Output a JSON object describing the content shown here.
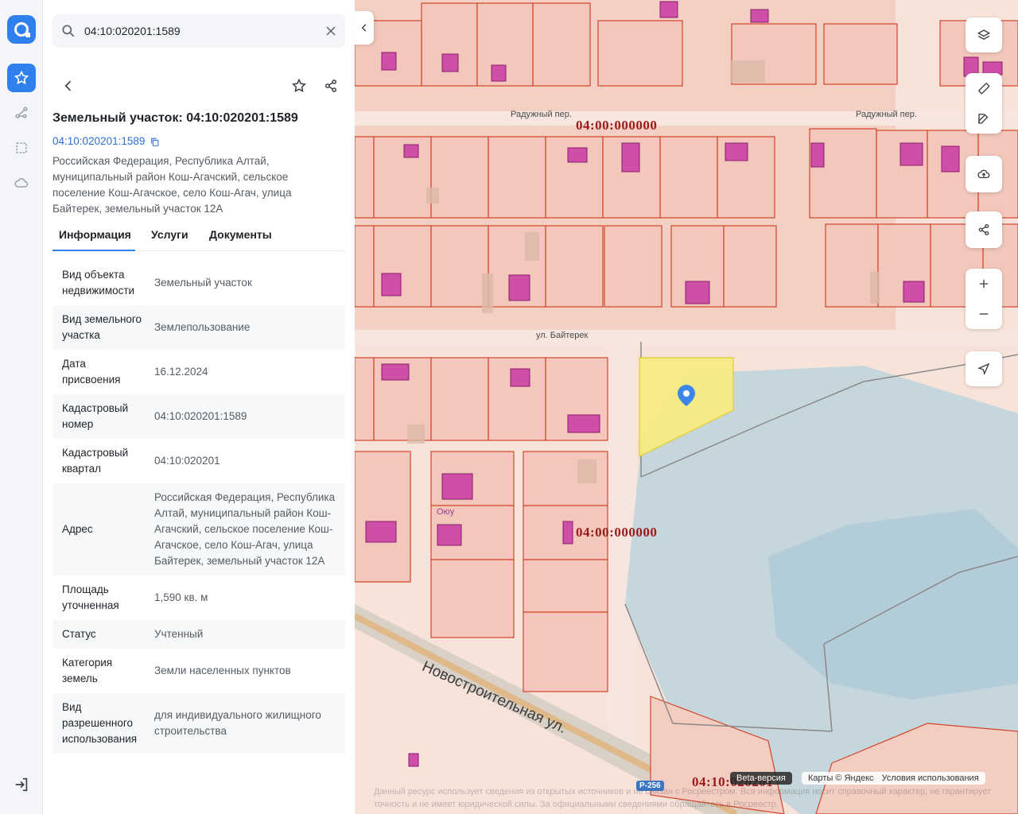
{
  "search": {
    "value": "04:10:020201:1589"
  },
  "panel": {
    "title": "Земельный участок: 04:10:020201:1589",
    "cad_number": "04:10:020201:1589",
    "address": "Российская Федерация, Республика Алтай, муниципальный район Кош-Агачский, сельское поселение Кош-Агачское, село Кош-Агач, улица Байтерек, земельный участок 12А",
    "tabs": [
      "Информация",
      "Услуги",
      "Документы"
    ],
    "properties": [
      {
        "key": "Вид объекта недвижимости",
        "value": "Земельный участок"
      },
      {
        "key": "Вид земельного участка",
        "value": "Землепользование"
      },
      {
        "key": "Дата присвоения",
        "value": "16.12.2024"
      },
      {
        "key": "Кадастровый номер",
        "value": "04:10:020201:1589"
      },
      {
        "key": "Кадастровый квартал",
        "value": "04:10:020201"
      },
      {
        "key": "Адрес",
        "value": "Российская Федерация, Республика Алтай, муниципальный район Кош-Агачский, сельское поселение Кош-Агачское, село Кош-Агач, улица Байтерек, земельный участок 12А"
      },
      {
        "key": "Площадь уточненная",
        "value": "1,590 кв. м"
      },
      {
        "key": "Статус",
        "value": "Учтенный"
      },
      {
        "key": "Категория земель",
        "value": "Земли населенных пунктов"
      },
      {
        "key": "Вид разрешенного использования",
        "value": "для индивидуального жилищного строительства"
      }
    ]
  },
  "map": {
    "streets": {
      "raduzhny": "Радужный пер.",
      "baiterek": "ул. Байтерек",
      "novostroitelnaya": "Новостроительная ул."
    },
    "quarters": [
      "04:00:000000",
      "04:00:000000",
      "04:10:020201"
    ],
    "poi": "Оюу",
    "road": "Р-256",
    "beta": "Beta-версия",
    "copyright": "Карты © Яндекс",
    "terms": "Условия использования",
    "disclaimer": "Данный ресурс использует сведения из открытых источников и не связан с Росреестром. Вся информация носит справочный характер, не гарантирует точность и не имеет юридической силы. За официальными сведениями обращайтесь в Росреестр."
  },
  "icons": {
    "rail": [
      "logo",
      "star-icon",
      "route-icon",
      "select-area-icon",
      "cloud-icon",
      "logout-icon"
    ],
    "map_controls": [
      "layers-icon",
      "ruler-icon",
      "edit-icon",
      "upload-icon",
      "share-icon",
      "zoom-in-icon",
      "zoom-out-icon",
      "locate-icon"
    ]
  },
  "colors": {
    "accent": "#2f80ed",
    "parcel_border": "#d2452a",
    "parcel_fill": "#f3c7bb",
    "building": "#c43fa0",
    "selected_parcel": "#f7ec84",
    "water": "#b9d3df"
  }
}
